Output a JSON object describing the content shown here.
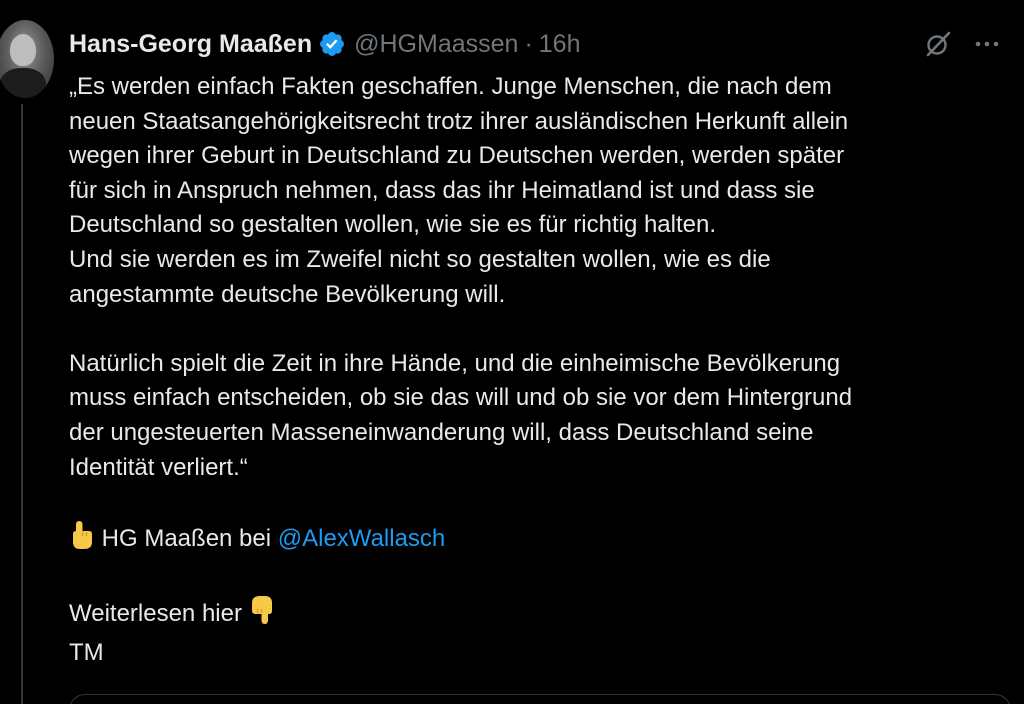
{
  "tweet": {
    "display_name": "Hans-Georg Maaßen",
    "handle": "@HGMaassen",
    "separator": "·",
    "time": "16h",
    "icons": {
      "verified": "verified-badge-icon",
      "grok": "grok-icon",
      "more": "more-options-icon",
      "pointing_up": "backhand-index-pointing-up-emoji",
      "pointing_down": "backhand-index-pointing-down-emoji"
    },
    "colors": {
      "background": "#000000",
      "text": "#e7e9ea",
      "secondary": "#71767b",
      "accent": "#1d9bf0",
      "emoji": "#f7c948"
    },
    "paragraph1": [
      "„Es werden einfach Fakten geschaffen. Junge Menschen, die nach dem",
      "neuen Staatsangehörigkeitsrecht trotz ihrer ausländischen Herkunft allein",
      "wegen ihrer Geburt in Deutschland zu Deutschen werden, werden später",
      "für sich in Anspruch nehmen, dass das ihr Heimatland ist und dass sie",
      "Deutschland so gestalten wollen, wie sie es für richtig halten.",
      "Und sie werden es im Zweifel nicht so gestalten wollen, wie es die",
      "angestammte deutsche Bevölkerung will."
    ],
    "paragraph2": [
      "Natürlich spielt die Zeit in ihre Hände, und die einheimische Bevölkerung",
      "muss einfach entscheiden, ob sie das will und ob sie vor dem Hintergrund",
      "der ungesteuerten Masseneinwanderung will, dass Deutschland seine",
      "Identität verliert.“"
    ],
    "source_text": "HG Maaßen bei",
    "mention": "@AlexWallasch",
    "read_more": "Weiterlesen hier",
    "signature": "TM"
  }
}
